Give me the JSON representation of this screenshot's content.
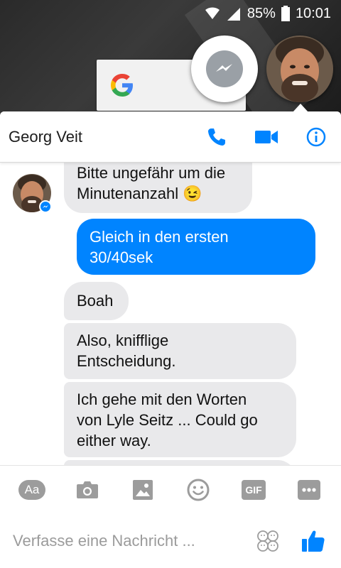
{
  "status_bar": {
    "battery": "85%",
    "time": "10:01"
  },
  "header": {
    "contact_name": "Georg Veit"
  },
  "messages": [
    {
      "direction": "in",
      "lines": [
        "Bitte ungefähr um die",
        "Minutenanzahl 😉"
      ]
    },
    {
      "direction": "out",
      "lines": [
        "Gleich in den ersten",
        "30/40sek"
      ]
    },
    {
      "direction": "in",
      "lines": [
        "Boah"
      ]
    },
    {
      "direction": "in",
      "lines": [
        "Also, knifflige",
        "Entscheidung."
      ]
    },
    {
      "direction": "in",
      "lines": [
        "Ich gehe mit den Worten",
        "von Lyle Seitz ... Could go",
        "either way."
      ]
    }
  ],
  "toolbar": {
    "text_format_label": "Aa",
    "gif_label": "GIF"
  },
  "composer": {
    "placeholder": "Verfasse eine Nachricht ..."
  },
  "colors": {
    "brand": "#0084ff",
    "incoming_bubble": "#e9e9eb",
    "icon_gray": "#9c9c9c"
  }
}
